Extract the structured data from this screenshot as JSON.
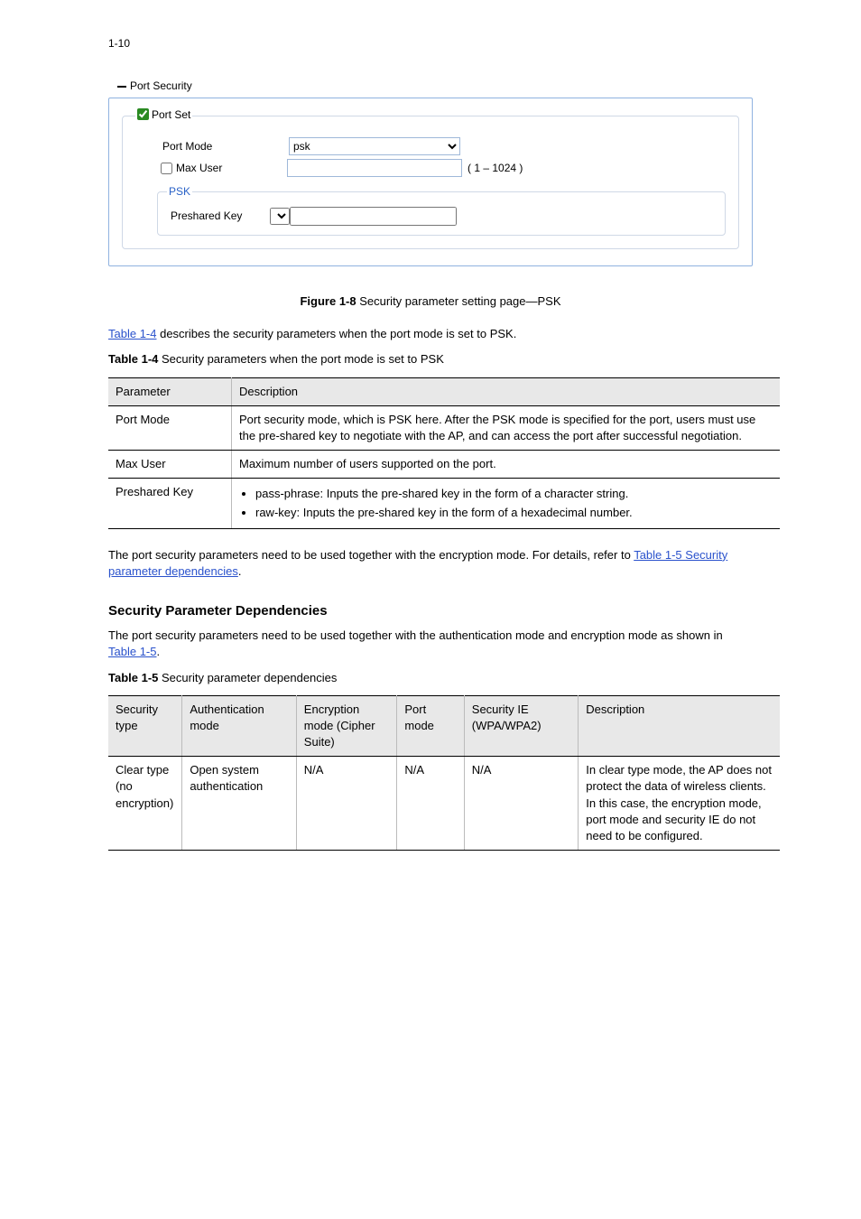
{
  "page_number": "1-10",
  "screenshot": {
    "section_label": "Port Security",
    "fieldset_label": "Port Set",
    "port_set_checked": true,
    "port_mode_label": "Port Mode",
    "port_mode_value": "psk",
    "max_user_label": "Max User",
    "max_user_value": "",
    "max_user_range": "( 1 – 1024 )",
    "psk_legend": "PSK",
    "psk_label": "Preshared Key",
    "psk_type_value": "",
    "psk_key_value": ""
  },
  "figure_caption_prefix": "Figure 1-8",
  "figure_caption_text": " Security parameter setting page—PSK",
  "table14_intro_text_part1": "Table 1-4",
  "table14_intro_text_part2": " describes the security parameters when the port mode is set to PSK.",
  "table14_caption_prefix": "Table 1-4",
  "table14_caption_text": " Security parameters when the port mode is set to PSK",
  "table14": {
    "headers": [
      "Parameter",
      "Description"
    ],
    "rows": [
      {
        "p": "Port Mode",
        "d": "Port security mode, which is PSK here. After the PSK mode is specified for the port, users must use the pre-shared key to negotiate with the AP, and can access the port after successful negotiation."
      },
      {
        "p": "Max User",
        "d": "Maximum number of users supported on the port."
      },
      {
        "p": "Preshared Key",
        "d_list": [
          "pass-phrase: Inputs the pre-shared key in the form of a character string.",
          "raw-key: Inputs the pre-shared key in the form of a hexadecimal number."
        ]
      }
    ]
  },
  "post_table14_para_parts": [
    "The port security parameters need to be used together with the encryption mode. For details, refer to ",
    "Table 1-5 Security parameter dependencies",
    "."
  ],
  "sec_dep_heading": "Security Parameter Dependencies",
  "sec_dep_para_parts": [
    "The port security parameters need to be used together with the authentication mode and encryption mode as shown in ",
    "Table 1-5",
    "."
  ],
  "table15_caption_prefix": "Table 1-5",
  "table15_caption_text": " Security parameter dependencies",
  "table15": {
    "headers": [
      "Security type",
      "Authentication mode",
      "Encryption mode (Cipher Suite)",
      "Port mode",
      "Security IE (WPA/WPA2)",
      "Description"
    ],
    "row1": [
      "Clear type (no encryption)",
      "Open system authentication",
      "N/A",
      "N/A",
      "N/A",
      "In clear type mode, the AP does not protect the data of wireless clients. In this case, the encryption mode, port mode and security IE do not need to be configured."
    ]
  }
}
